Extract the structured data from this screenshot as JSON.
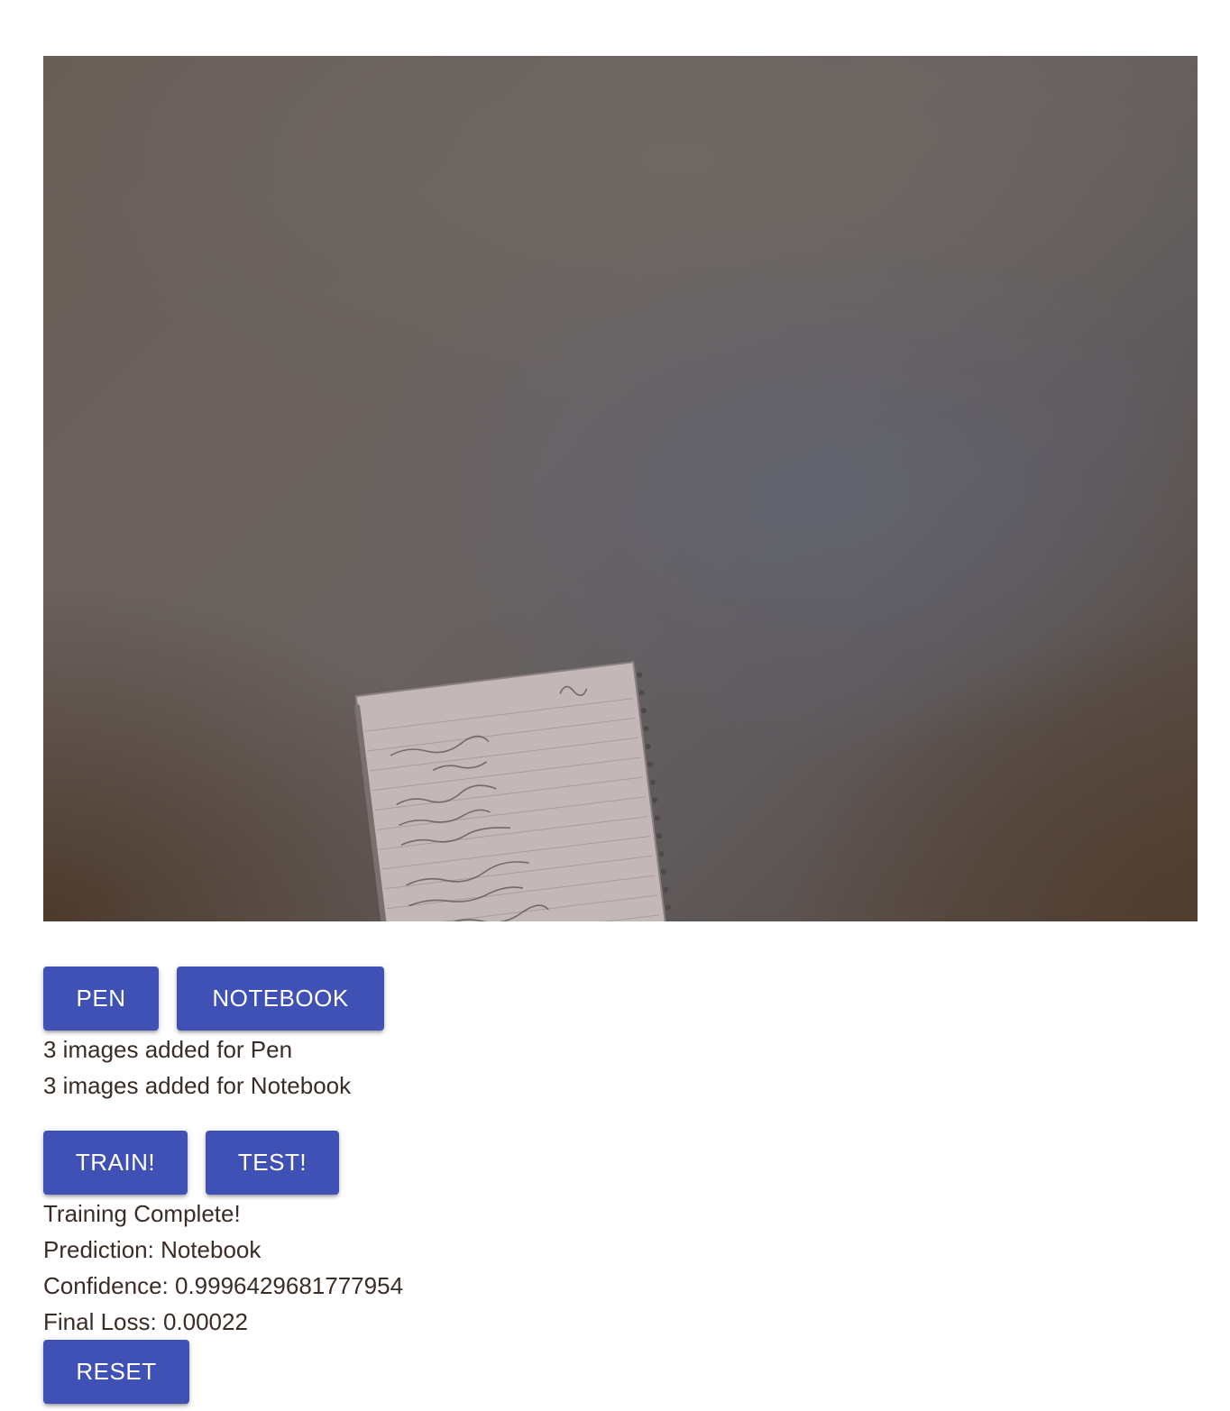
{
  "webcam": {
    "icon": "webcam-feed-image"
  },
  "class_buttons": {
    "pen_label": "PEN",
    "notebook_label": "NOTEBOOK"
  },
  "counts": {
    "pen": "3 images added for Pen",
    "notebook": "3 images added for Notebook"
  },
  "actions": {
    "train_label": "TRAIN!",
    "test_label": "TEST!"
  },
  "results": {
    "training_status": "Training Complete!",
    "prediction": "Prediction: Notebook",
    "confidence": "Confidence: 0.9996429681777954",
    "final_loss": "Final Loss: 0.00022"
  },
  "reset_label": "RESET",
  "colors": {
    "button_bg": "#3f51b5",
    "button_text": "#ffffff",
    "text": "#3a2c26"
  }
}
